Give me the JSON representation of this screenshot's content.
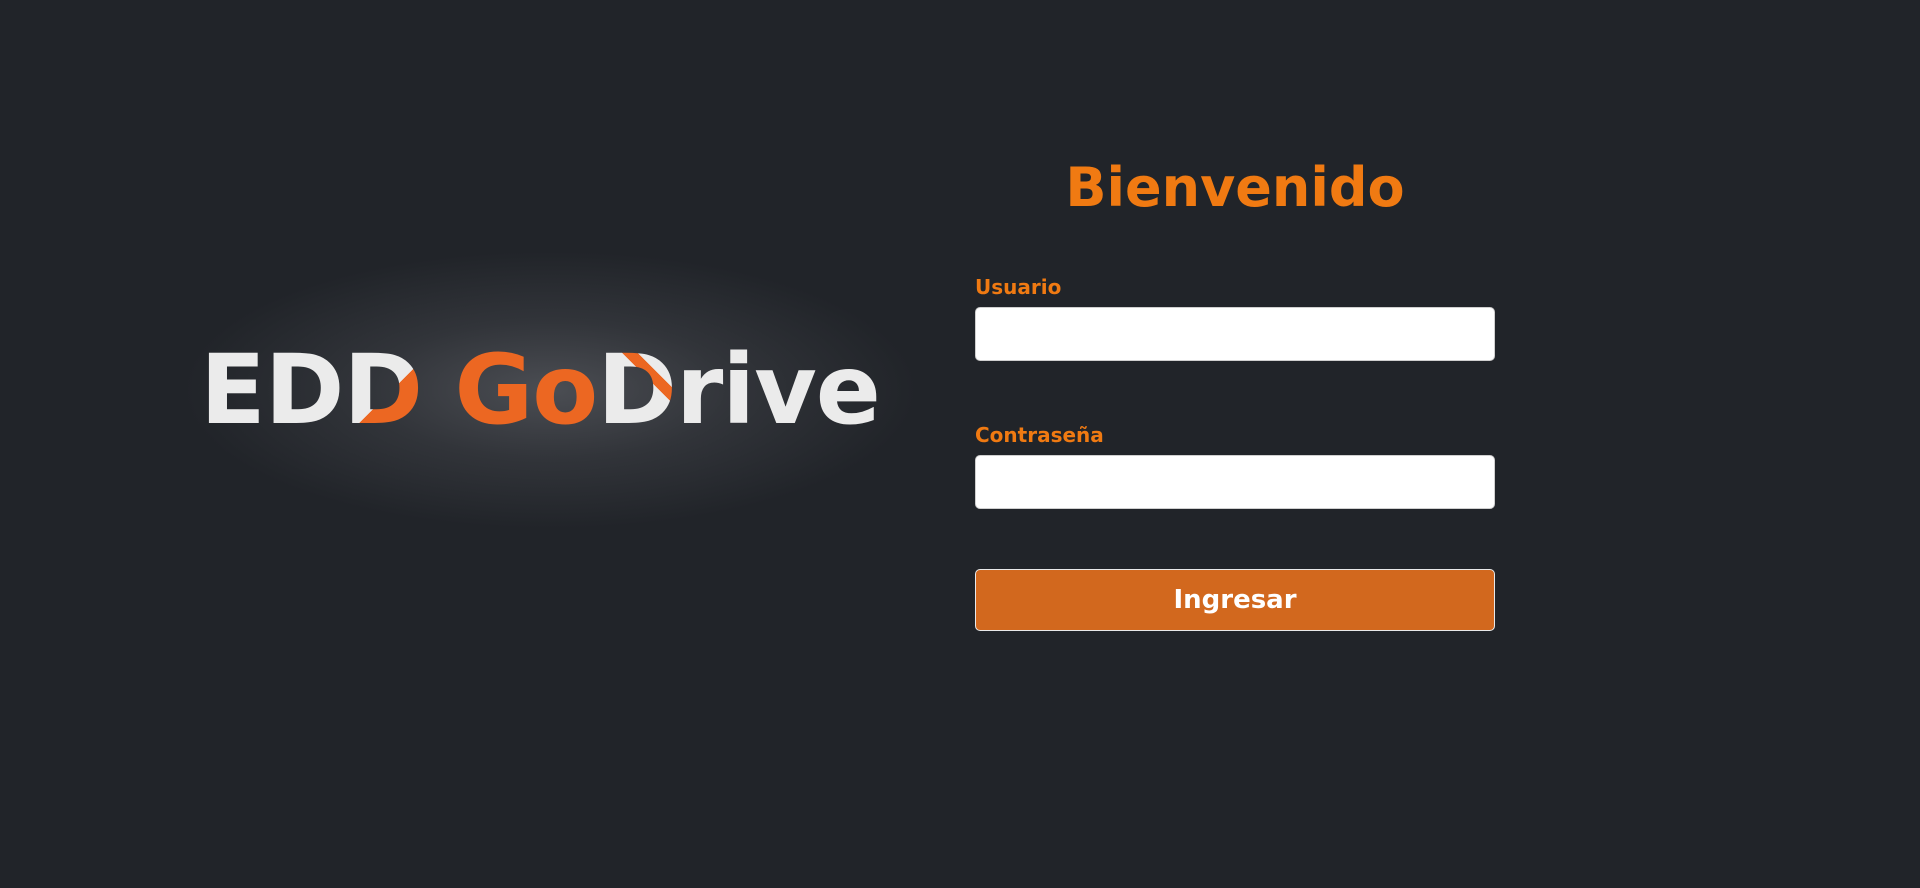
{
  "brand": {
    "logo_text": "EDD GoDrive",
    "colors": {
      "white": "#ebebeb",
      "orange": "#ec6722"
    }
  },
  "login": {
    "title": "Bienvenido",
    "username_label": "Usuario",
    "username_value": "",
    "password_label": "Contraseña",
    "password_value": "",
    "submit_label": "Ingresar"
  },
  "theme": {
    "background": "#212429",
    "accent": "#f07a12",
    "button_bg": "#d2681e"
  }
}
